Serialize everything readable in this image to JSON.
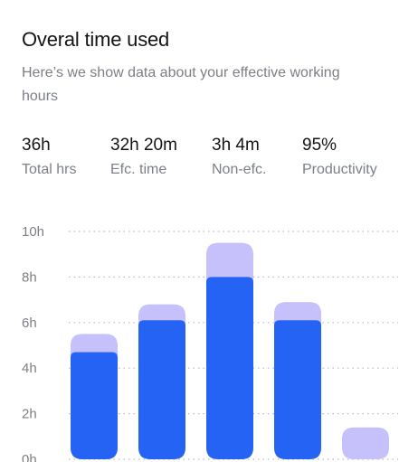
{
  "header": {
    "title": "Overal time used",
    "subtitle": "Here’s we show data about your effective working hours"
  },
  "stats": [
    {
      "value": "36h",
      "label": "Total hrs"
    },
    {
      "value": "32h 20m",
      "label": "Efc. time"
    },
    {
      "value": "3h 4m",
      "label": "Non-efc."
    },
    {
      "value": "95%",
      "label": "Productivity"
    }
  ],
  "colors": {
    "effective": "#2563f5",
    "non_effective": "#c7c1fb",
    "grid": "#b8bbc2",
    "text_muted": "#7b7f87"
  },
  "chart_data": {
    "type": "bar",
    "stacked": true,
    "categories": [
      "",
      "",
      "",
      "",
      ""
    ],
    "series": [
      {
        "values": [
          4.7,
          6.1,
          8.0,
          6.1,
          0
        ]
      },
      {
        "values": [
          0.8,
          0.7,
          1.5,
          0.8,
          1.4
        ]
      }
    ],
    "yticks": [
      "0h",
      "2h",
      "4h",
      "6h",
      "8h",
      "10h"
    ],
    "ylim": [
      0,
      10
    ],
    "grid": true
  }
}
